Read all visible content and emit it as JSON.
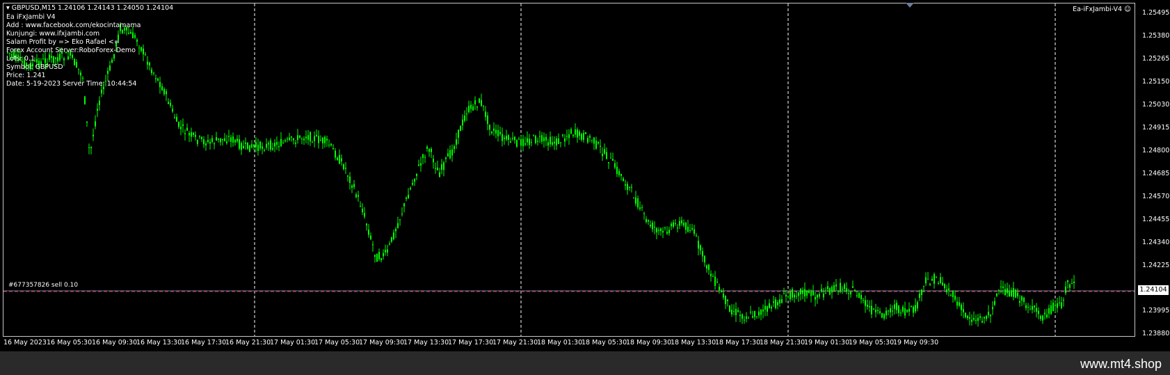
{
  "chart": {
    "header": "GBPUSD,M15  1.24106 1.24143 1.24050 1.24104",
    "ea_name": "Ea-iFxJambi-V4",
    "info_lines": [
      "Ea iFxJambi V4",
      "Add : www.facebook.com/ekocintamama",
      "Kunjungi: www.ifxjambi.com",
      "Salam Profit by => Eko Rafael <=",
      "Forex Account Server:RoboForex-Demo",
      "Lots: 0.1",
      "Symbol: GBPUSD",
      "Price:  1.241",
      "Date: 5-19-2023 Server Time: 10:44:54"
    ],
    "order_label": "#677357826 sell 0.10",
    "current_price": "1.24104",
    "y_axis_labels": [
      "1.25495",
      "1.25380",
      "1.25265",
      "1.25150",
      "1.25030",
      "1.24915",
      "1.24800",
      "1.24685",
      "1.24570",
      "1.24455",
      "1.24340",
      "1.24225",
      "1.24104",
      "1.23995",
      "1.23880"
    ],
    "x_axis_labels": [
      "16 May 2023",
      "16 May 05:30",
      "16 May 09:30",
      "16 May 13:30",
      "16 May 17:30",
      "16 May 21:30",
      "17 May 01:30",
      "17 May 05:30",
      "17 May 09:30",
      "17 May 13:30",
      "17 May 17:30",
      "17 May 21:30",
      "18 May 01:30",
      "18 May 05:30",
      "18 May 09:30",
      "18 May 13:30",
      "18 May 17:30",
      "18 May 21:30",
      "19 May 01:30",
      "19 May 05:30",
      "19 May 09:30"
    ],
    "colors": {
      "candles": "#00ff00",
      "grid": "#ffffff",
      "order_line": "#ff3b00",
      "price_line": "#4c79c9"
    }
  },
  "footer": {
    "site": "www.mt4.shop"
  }
}
